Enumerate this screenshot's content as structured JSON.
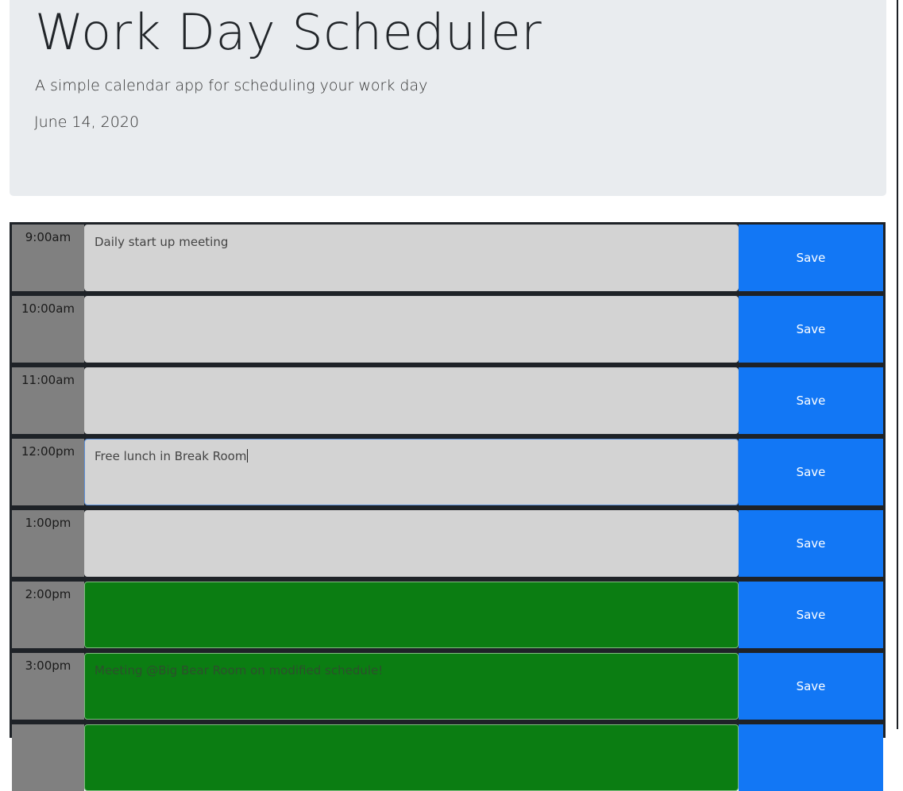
{
  "header": {
    "title": "Work Day Scheduler",
    "subtitle": "A simple calendar app for scheduling your work day",
    "date": "June 14, 2020"
  },
  "colors": {
    "past": "#d3d3d3",
    "present": "#d3d3d3",
    "future": "#0b7d12",
    "save_button": "#1277f5",
    "hour_column": "#808080"
  },
  "save_label": "Save",
  "time_blocks": [
    {
      "hour": "9:00am",
      "text": "Daily start up meeting",
      "state": "past"
    },
    {
      "hour": "10:00am",
      "text": "",
      "state": "past"
    },
    {
      "hour": "11:00am",
      "text": "",
      "state": "past"
    },
    {
      "hour": "12:00pm",
      "text": "Free lunch in Break Room",
      "state": "present"
    },
    {
      "hour": "1:00pm",
      "text": "",
      "state": "past"
    },
    {
      "hour": "2:00pm",
      "text": "",
      "state": "future"
    },
    {
      "hour": "3:00pm",
      "text": "Meeting @Big Bear Room on modified schedule!",
      "state": "future"
    },
    {
      "hour": "",
      "text": "",
      "state": "future"
    }
  ]
}
